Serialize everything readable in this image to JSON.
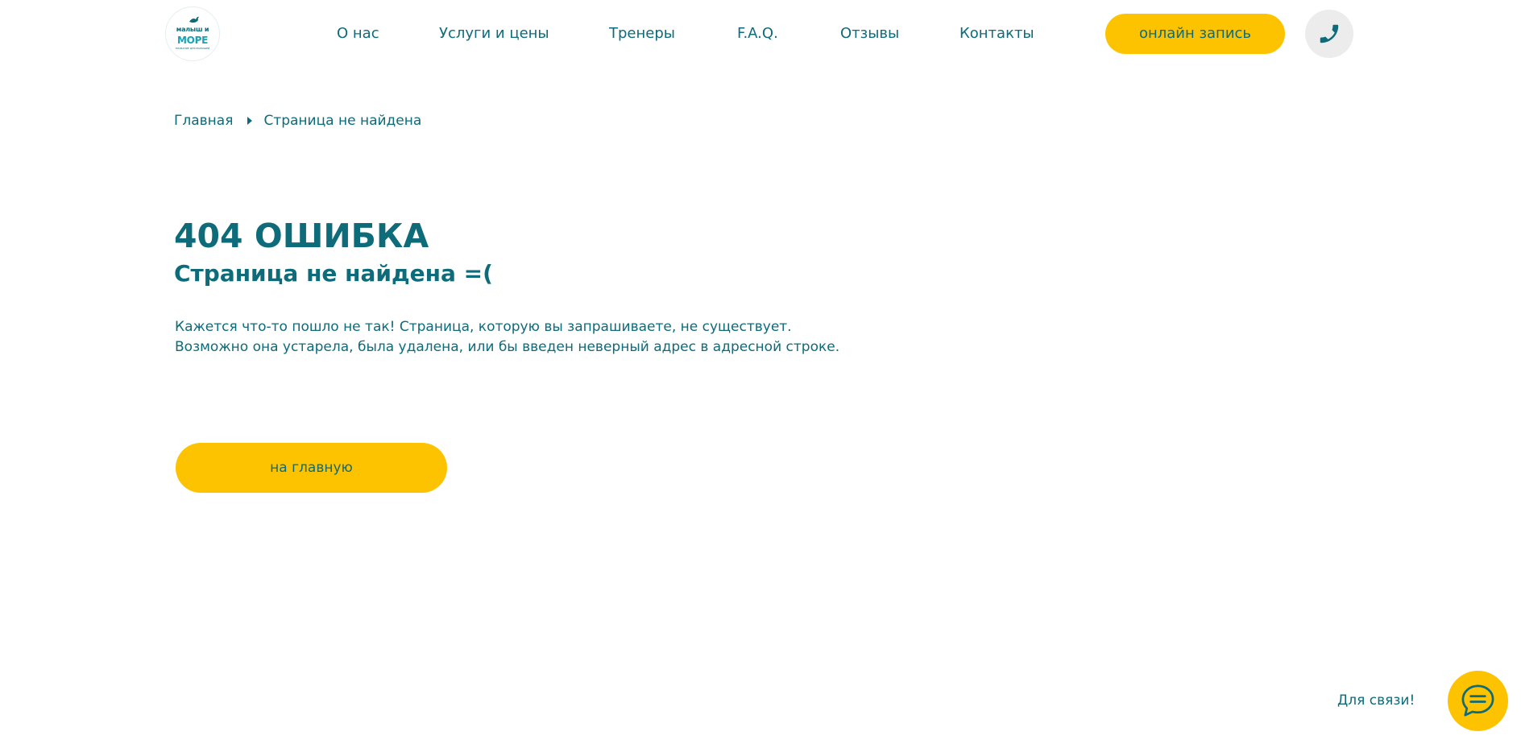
{
  "header": {
    "logo": {
      "line1": "малыш и",
      "line2": "МОРЕ",
      "line3": "ПЛАВАНИЕ ДЛЯ МАЛЫШЕЙ"
    },
    "nav": [
      {
        "label": "О нас",
        "icon": ""
      },
      {
        "label": "Услуги и цены",
        "icon": ""
      },
      {
        "label": "Тренеры",
        "icon": ""
      },
      {
        "label": "F.A.Q.",
        "icon": ""
      },
      {
        "label": "Отзывы",
        "icon": ""
      },
      {
        "label": "Контакты",
        "icon": ""
      }
    ],
    "cta_label": "онлайн запись",
    "phone_icon": "phone-icon"
  },
  "breadcrumb": {
    "home": "Главная",
    "current": "Страница не найдена"
  },
  "main": {
    "title": "404 ОШИБКА",
    "subtitle": "Страница не найдена =(",
    "desc_line1": "Кажется что-то пошло не так! Страница, которую вы запрашиваете, не существует.",
    "desc_line2": "Возможно она устарела, была удалена, или бы введен неверный адрес в адресной строке.",
    "home_button": "на главную"
  },
  "chat": {
    "label": "Для связи!",
    "icon": "chat-bubble-icon"
  },
  "colors": {
    "primary_text": "#0d6b7a",
    "accent": "#fdc300",
    "phone_bg": "#ececec",
    "background": "#ffffff"
  }
}
